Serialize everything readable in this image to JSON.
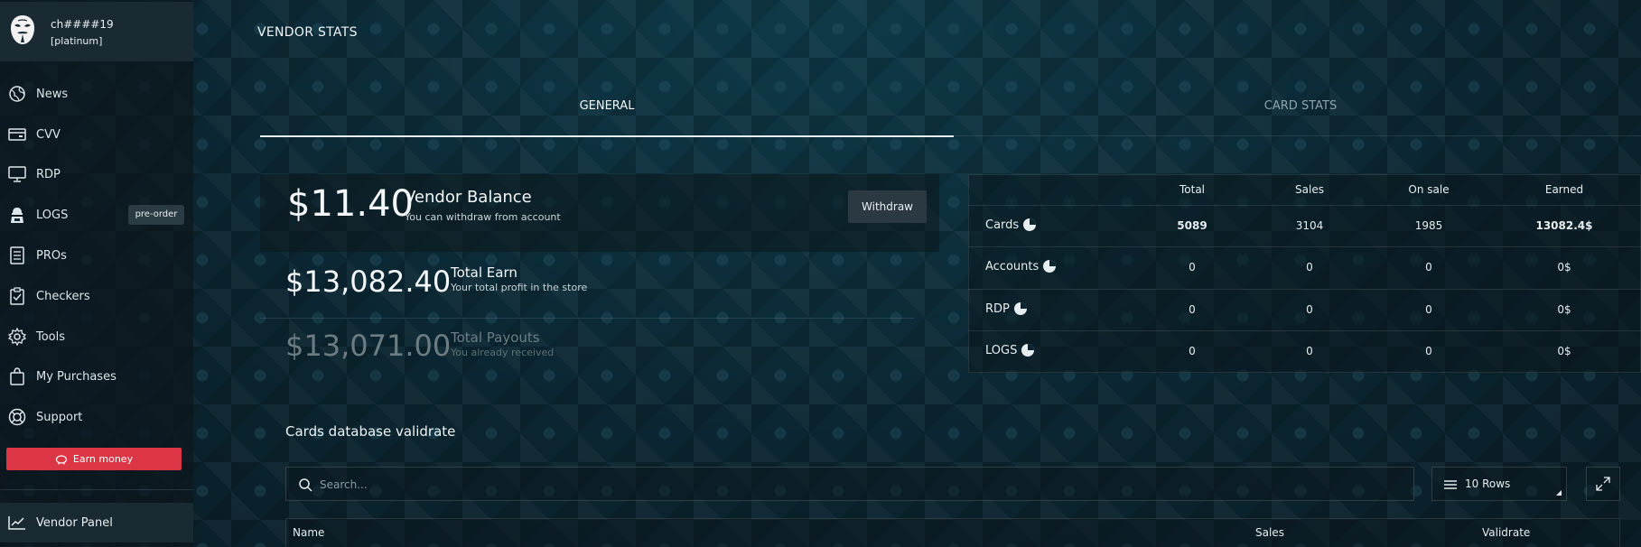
{
  "user": {
    "name": "ch####19",
    "rank": "[platinum]"
  },
  "sidebar": {
    "items": [
      {
        "label": "News"
      },
      {
        "label": "CVV"
      },
      {
        "label": "RDP"
      },
      {
        "label": "LOGS"
      },
      {
        "label": "PROs"
      },
      {
        "label": "Checkers"
      },
      {
        "label": "Tools"
      },
      {
        "label": "My Purchases"
      },
      {
        "label": "Support"
      }
    ],
    "logs_badge": "pre-order",
    "earn_button": "Earn money",
    "vendor_panel": "Vendor Panel"
  },
  "page": {
    "title": "VENDOR STATS"
  },
  "tabs": [
    {
      "label": "GENERAL",
      "active": true
    },
    {
      "label": "CARD STATS",
      "active": false
    }
  ],
  "balance": {
    "amount": "$11.40",
    "title": "Vendor Balance",
    "subtitle": "You can withdraw from account",
    "withdraw_label": "Withdraw"
  },
  "total_earn": {
    "amount": "$13,082.40",
    "title": "Total Earn",
    "subtitle": "Your total profit in the store"
  },
  "total_payouts": {
    "amount": "$13,071.00",
    "title": "Total Payouts",
    "subtitle": "You already received"
  },
  "stats_table": {
    "headers": [
      "Total",
      "Sales",
      "On sale",
      "Earned"
    ],
    "rows": [
      {
        "label": "Cards",
        "values": [
          "5089",
          "3104",
          "1985",
          "13082.4$"
        ]
      },
      {
        "label": "Accounts",
        "values": [
          "0",
          "0",
          "0",
          "0$"
        ]
      },
      {
        "label": "RDP",
        "values": [
          "0",
          "0",
          "0",
          "0$"
        ]
      },
      {
        "label": "LOGS",
        "values": [
          "0",
          "0",
          "0",
          "0$"
        ]
      }
    ]
  },
  "cards_db": {
    "title": "Cards database validrate",
    "search_placeholder": "Search...",
    "rows_label": "10 Rows",
    "columns": [
      "Name",
      "Sales",
      "Validrate"
    ]
  },
  "colors": {
    "accent_red": "#dc3545",
    "background": "#0c2430",
    "sidebar": "#1a2a33"
  }
}
